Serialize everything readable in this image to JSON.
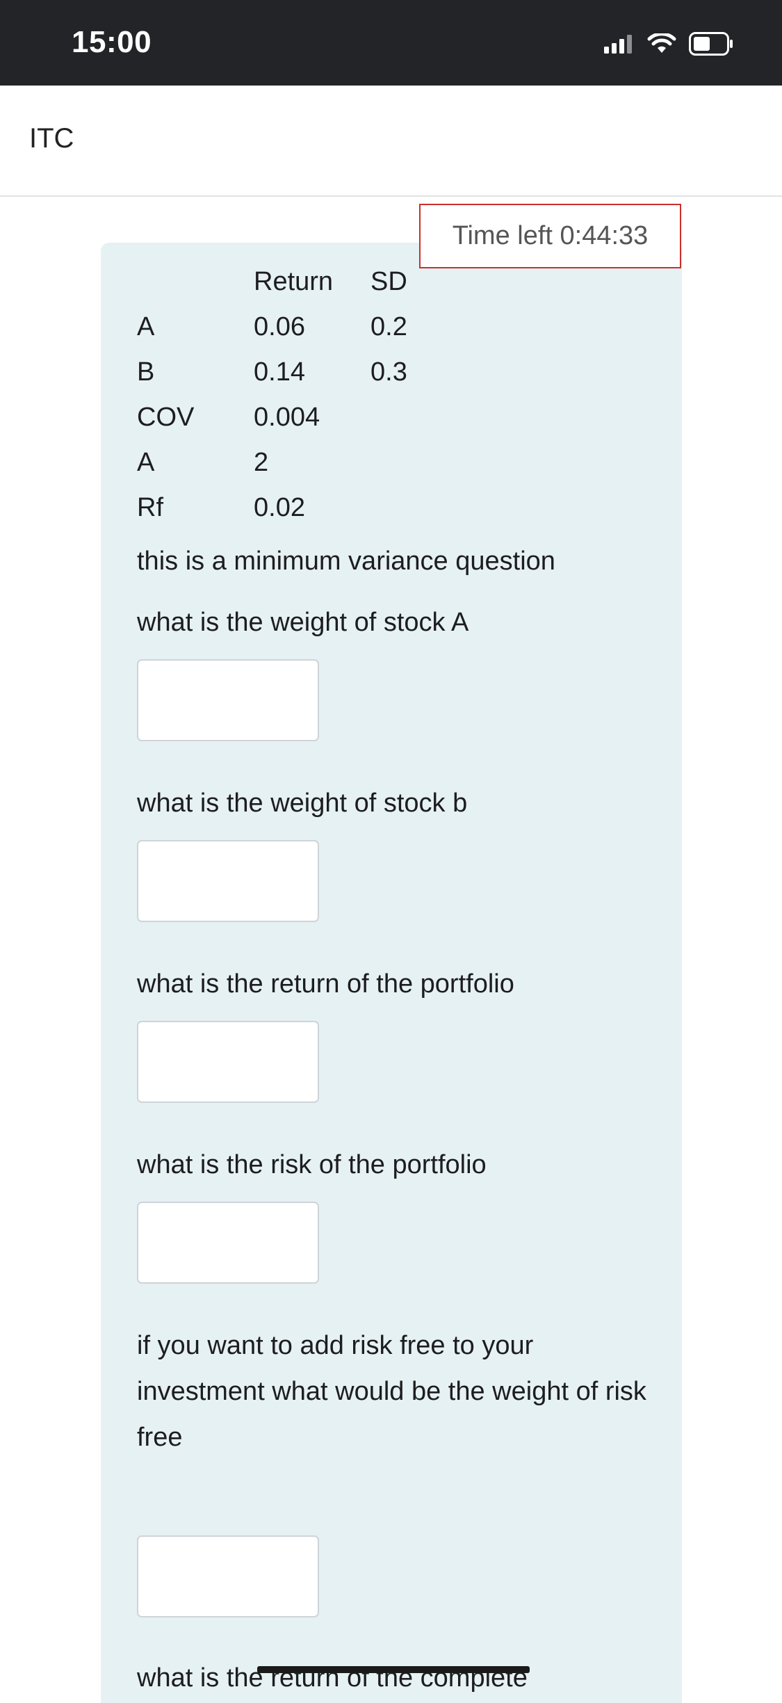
{
  "status_bar": {
    "time": "15:00"
  },
  "header": {
    "title": "ITC"
  },
  "timer": {
    "text": "Time left 0:44:33"
  },
  "data_table": {
    "headers": [
      "",
      "Return",
      "SD"
    ],
    "rows": [
      [
        "A",
        "0.06",
        "0.2"
      ],
      [
        "B",
        "0.14",
        "0.3"
      ],
      [
        "COV",
        "0.004",
        ""
      ],
      [
        "A",
        "2",
        ""
      ],
      [
        "Rf",
        "0.02",
        ""
      ]
    ]
  },
  "questions": {
    "intro": "this is a minimum variance question",
    "q1": "what is the weight of stock A",
    "q2": "what is the weight of stock b",
    "q3": "what is the return of the portfolio",
    "q4": "what is the risk of the portfolio",
    "q5": "if you want to add risk free to your investment what would be the weight of risk free",
    "q6": "what is the return of the complete"
  },
  "inputs": {
    "answer1": "",
    "answer2": "",
    "answer3": "",
    "answer4": "",
    "answer5": ""
  },
  "colors": {
    "status_bar_bg": "#232427",
    "card_bg": "#e6f1f3",
    "timer_border": "#c9302c"
  },
  "icons": [
    "signal-icon",
    "wifi-icon",
    "battery-icon"
  ]
}
